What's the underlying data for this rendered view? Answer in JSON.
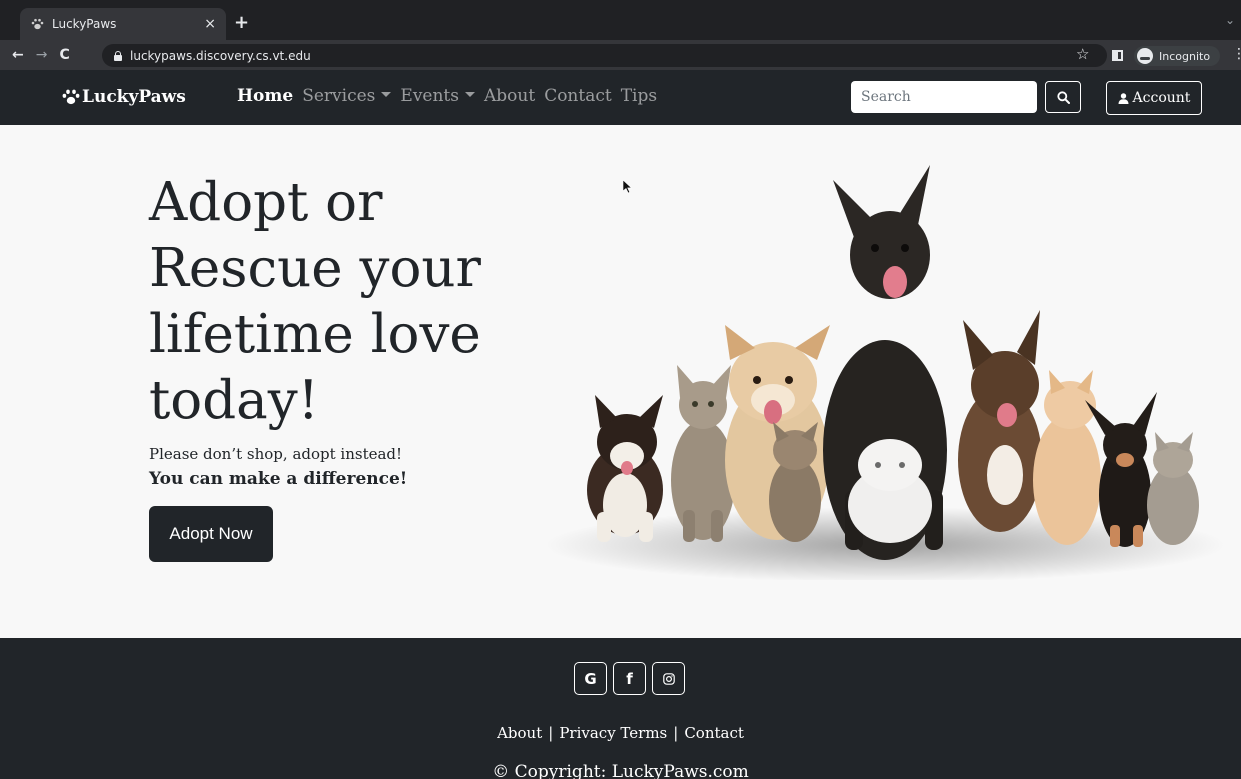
{
  "browser": {
    "tab_title": "LuckyPaws",
    "tab_close": "×",
    "new_tab": "+",
    "url": "luckypaws.discovery.cs.vt.edu",
    "incognito_label": "Incognito"
  },
  "navbar": {
    "brand": "LuckyPaws",
    "links": {
      "home": "Home",
      "services": "Services",
      "events": "Events",
      "about": "About",
      "contact": "Contact",
      "tips": "Tips"
    },
    "search_placeholder": "Search",
    "account_label": "Account"
  },
  "hero": {
    "title": "Adopt or Rescue your lifetime love today!",
    "subtitle": "Please don’t shop, adopt instead!",
    "tagline": "You can make a difference!",
    "cta": "Adopt Now"
  },
  "footer": {
    "social": [
      "G",
      "f",
      "◎"
    ],
    "links": [
      "About",
      "Privacy Terms",
      "Contact"
    ],
    "separator": "|",
    "copyright": "© Copyright: LuckyPaws.com"
  },
  "colors": {
    "navbar_bg": "#212529",
    "hero_bg": "#f8f8f8",
    "button_bg": "#212529"
  }
}
